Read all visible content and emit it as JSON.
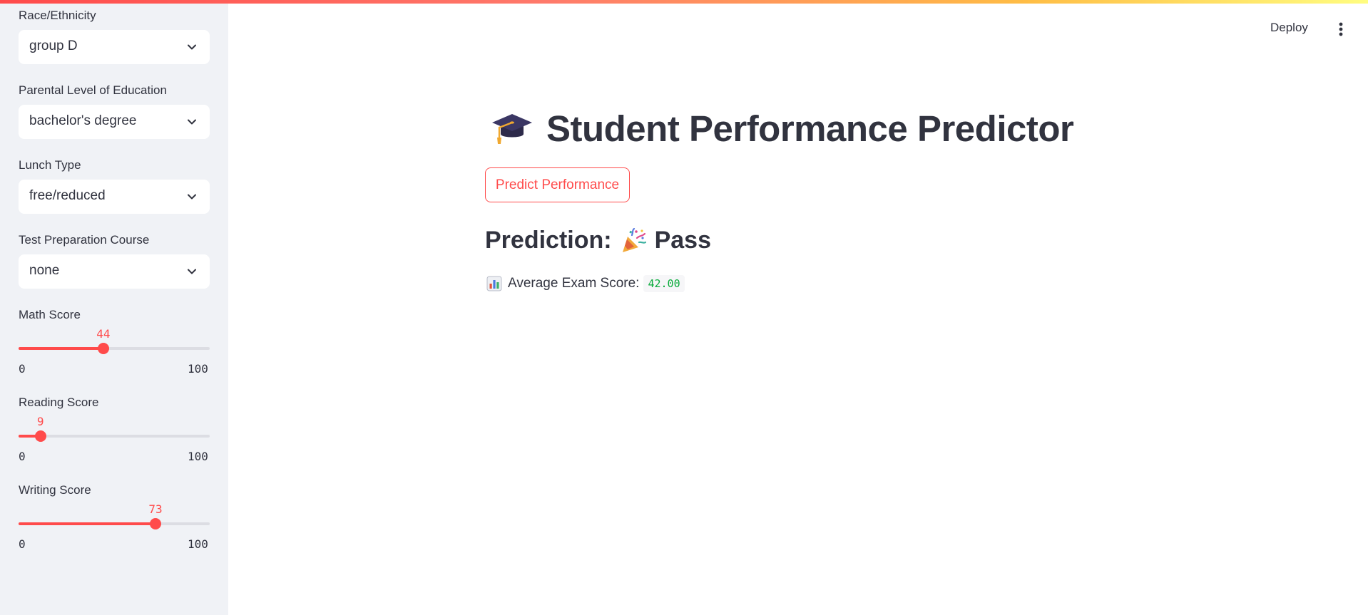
{
  "sidebar": {
    "selects": [
      {
        "label": "Race/Ethnicity",
        "value": "group D"
      },
      {
        "label": "Parental Level of Education",
        "value": "bachelor's degree"
      },
      {
        "label": "Lunch Type",
        "value": "free/reduced"
      },
      {
        "label": "Test Preparation Course",
        "value": "none"
      }
    ],
    "sliders": [
      {
        "label": "Math Score",
        "value": "44",
        "fraction": 0.44,
        "min": "0",
        "max": "100"
      },
      {
        "label": "Reading Score",
        "value": "9",
        "fraction": 0.09,
        "min": "0",
        "max": "100"
      },
      {
        "label": "Writing Score",
        "value": "73",
        "fraction": 0.73,
        "min": "0",
        "max": "100"
      }
    ]
  },
  "header": {
    "deploy_label": "Deploy",
    "menu_icon": "vertical-ellipsis-icon"
  },
  "main": {
    "title": "Student Performance Predictor",
    "title_icon": "graduation-cap-icon",
    "predict_button": "Predict Performance",
    "prediction_label": "Prediction:",
    "prediction_icon": "party-popper-icon",
    "prediction_value": "Pass",
    "score_icon": "bar-chart-icon",
    "score_label": "Average Exam Score:",
    "score_value": "42.00"
  },
  "colors": {
    "accent": "#ff4b4b",
    "sidebar_bg": "#f0f2f6",
    "text": "#31333f",
    "code_green": "#09ab3b"
  }
}
